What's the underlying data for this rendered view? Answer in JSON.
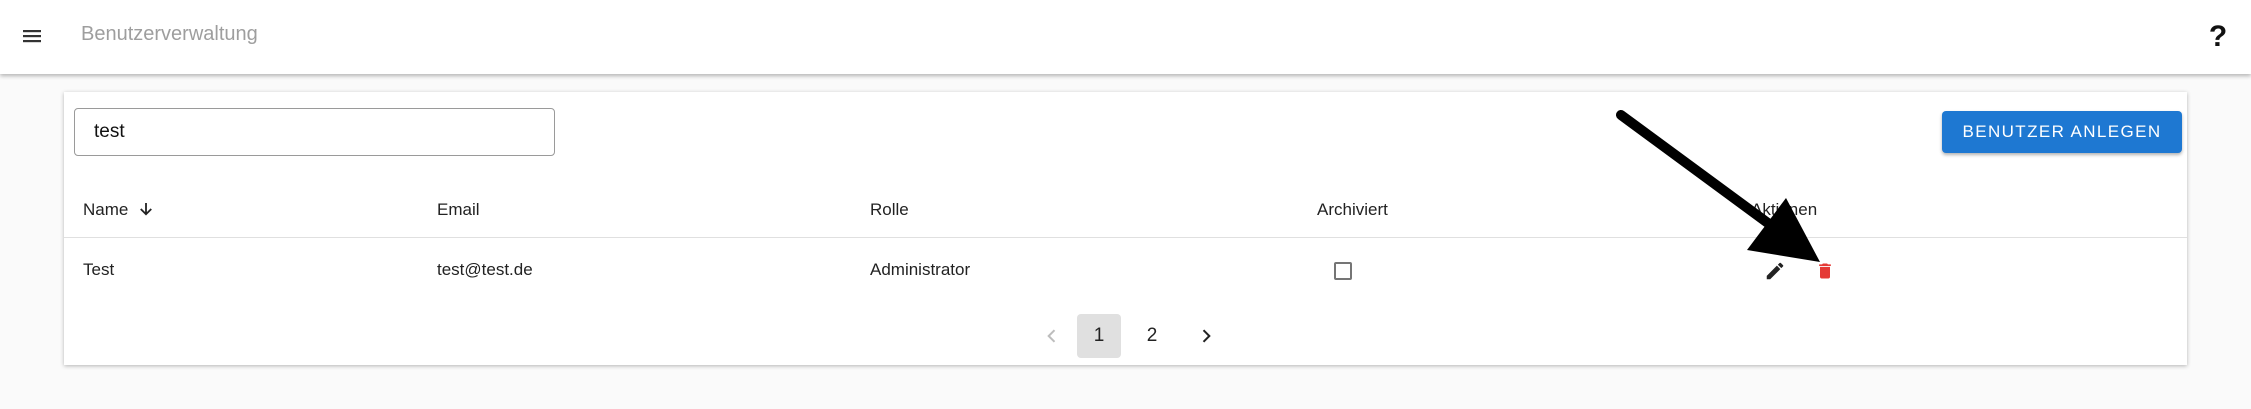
{
  "header": {
    "title": "Benutzerverwaltung",
    "menu_icon": "hamburger-menu-icon",
    "help_label": "?"
  },
  "search": {
    "value": "test",
    "placeholder": ""
  },
  "actions": {
    "add_user_label": "BENUTZER ANLEGEN"
  },
  "table": {
    "columns": {
      "name": "Name",
      "email": "Email",
      "role": "Rolle",
      "archived": "Archiviert",
      "actions": "Aktionen"
    },
    "sort": {
      "column": "name",
      "direction": "descending",
      "icon": "arrow-down-icon"
    },
    "rows": [
      {
        "name": "Test",
        "email": "test@test.de",
        "role": "Administrator",
        "archived": false,
        "edit_icon": "pencil-icon",
        "delete_icon": "trash-icon"
      }
    ]
  },
  "pagination": {
    "prev_icon": "chevron-left-icon",
    "pages": [
      "1",
      "2"
    ],
    "current": "1",
    "next_icon": "chevron-right-icon"
  },
  "colors": {
    "primary": "#1e78d2",
    "delete": "#e53935",
    "title_muted": "#9e9e9e",
    "annotation_arrow": "#000000"
  }
}
